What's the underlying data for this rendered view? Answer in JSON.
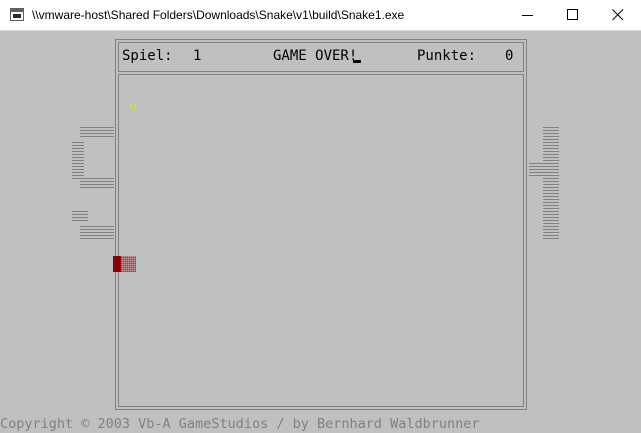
{
  "window": {
    "title": "\\\\vmware-host\\Shared Folders\\Downloads\\Snake\\v1\\build\\Snake1.exe",
    "minimize_icon": "minimize-icon",
    "maximize_icon": "maximize-icon",
    "close_icon": "close-icon"
  },
  "status": {
    "game_label": "Spiel:",
    "game_value": "1",
    "message": "GAME OVER!",
    "score_label": "Punkte:",
    "score_value": "0"
  },
  "side_digits": {
    "left": "0",
    "right": "1",
    "color": "#808080"
  },
  "colors": {
    "background": "#c0c0c0",
    "frame": "#808080",
    "snake_head": "#8b0000",
    "snake_body": "#c9a3a3",
    "food": "#e6e600",
    "copyright": "#808080"
  },
  "footer": {
    "copyright": "Copyright © 2003 Vb-A GameStudios / by Bernhard Waldbrunner"
  }
}
